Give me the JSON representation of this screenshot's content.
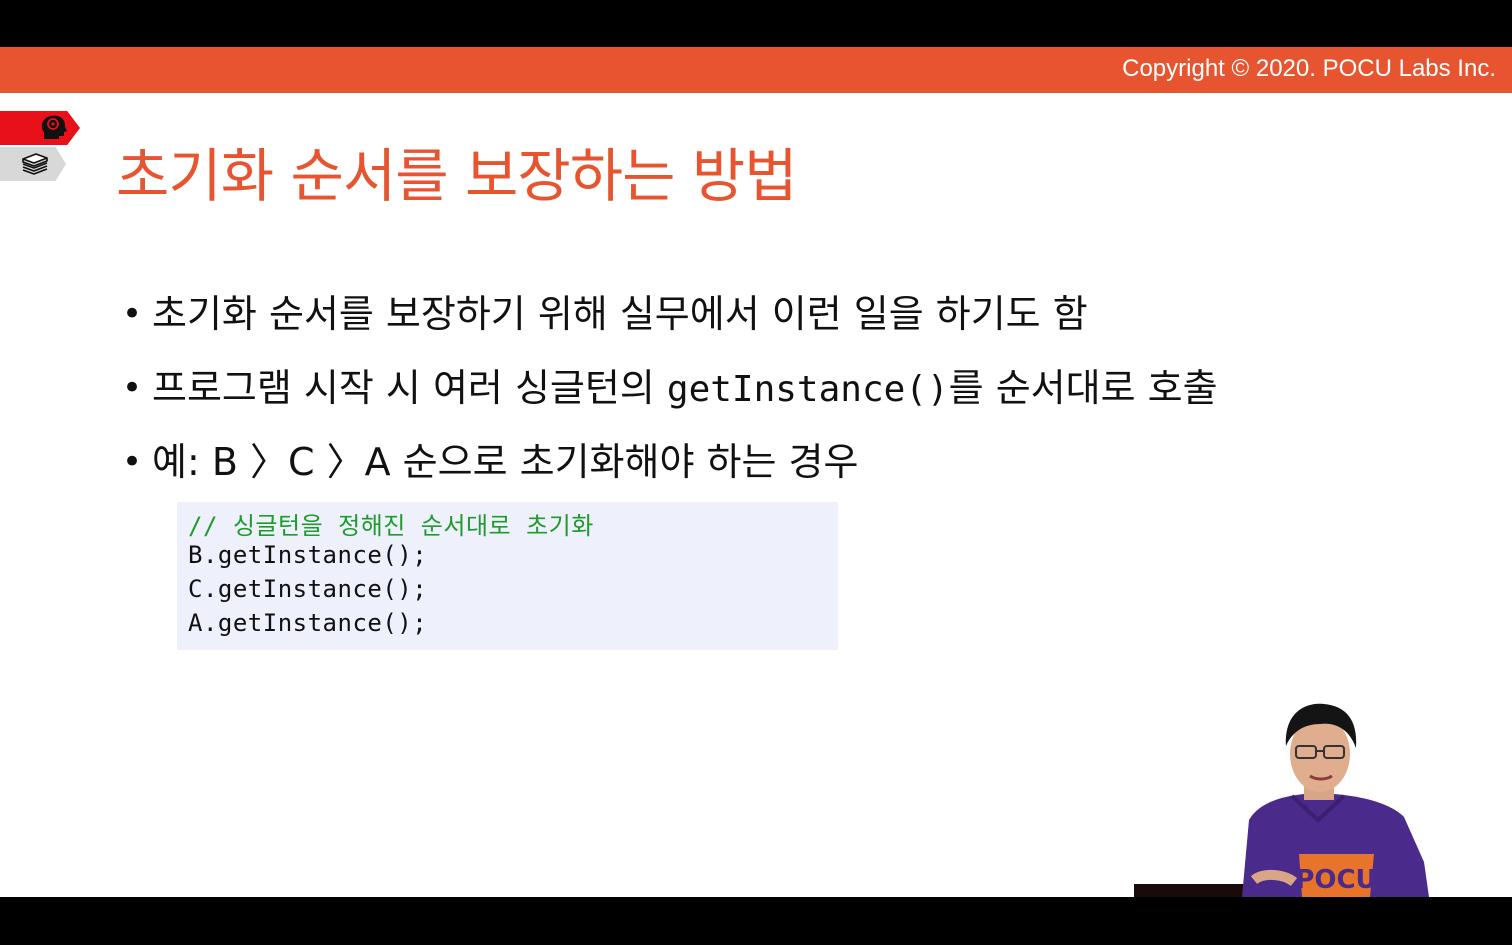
{
  "header": {
    "copyright": "Copyright © 2020. POCU Labs Inc."
  },
  "sidebar_icons": [
    {
      "name": "brain-head-icon"
    },
    {
      "name": "book-stack-icon"
    }
  ],
  "slide": {
    "title": "초기화 순서를 보장하는 방법",
    "bullets": [
      {
        "text": "초기화 순서를 보장하기 위해 실무에서 이런 일을 하기도 함"
      },
      {
        "pre": "프로그램 시작 시 여러 싱글턴의 ",
        "code": "getInstance()",
        "post": "를 순서대로 호출"
      },
      {
        "text": "예: B 〉C 〉A 순으로 초기화해야 하는 경우"
      }
    ],
    "code_block": {
      "comment": "// 싱글턴을 정해진 순서대로 초기화",
      "lines": [
        "B.getInstance();",
        "C.getInstance();",
        "A.getInstance();"
      ]
    }
  },
  "presenter": {
    "shirt_text": "POCU"
  },
  "colors": {
    "accent": "#e65530",
    "tab_red": "#e8111a",
    "code_bg": "#eef0fb",
    "comment": "#1f9a2c",
    "shirt": "#4a2a8a"
  }
}
